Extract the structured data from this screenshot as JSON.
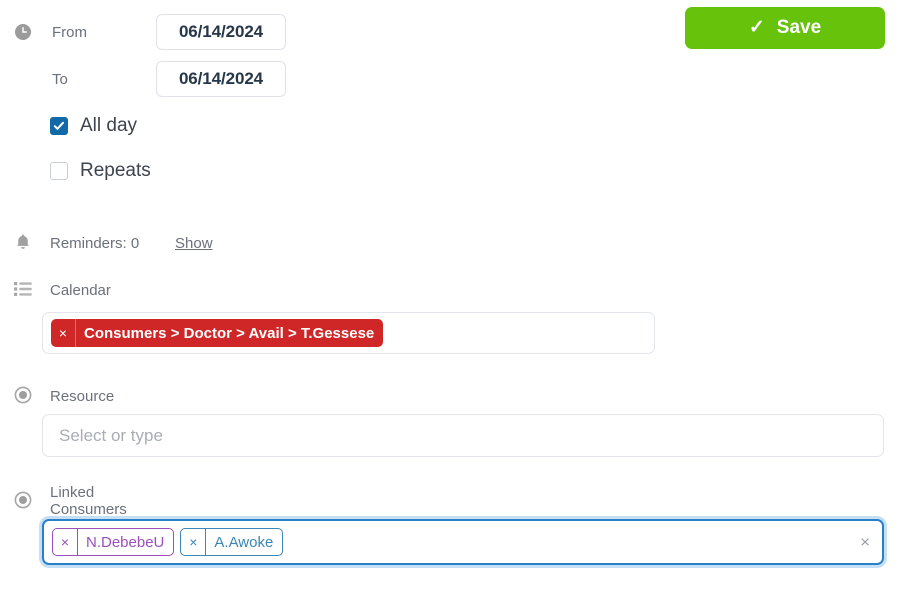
{
  "form": {
    "from": {
      "label": "From",
      "value": "06/14/2024",
      "icon": "clock-icon"
    },
    "to": {
      "label": "To",
      "value": "06/14/2024"
    },
    "all_day": {
      "label": "All day",
      "checked": true
    },
    "repeats": {
      "label": "Repeats",
      "checked": false
    },
    "reminders": {
      "icon": "bell-icon",
      "text": "Reminders: 0",
      "show_link": "Show"
    },
    "calendar": {
      "icon": "list-icon",
      "label": "Calendar",
      "tags": [
        {
          "label": "Consumers > Doctor > Avail > T.Gessese",
          "remove": "×",
          "color": "#cf2727",
          "style": "solid"
        }
      ]
    },
    "resource": {
      "icon": "radio-icon",
      "label": "Resource",
      "placeholder": "Select or type",
      "value": ""
    },
    "linked_consumers": {
      "icon": "radio-icon",
      "label": "Linked Consumers",
      "focused": true,
      "clear_all": "×",
      "tags": [
        {
          "label": "N.DebebeU",
          "remove": "×",
          "color": "#9b4fbd",
          "style": "outline"
        },
        {
          "label": "A.Awoke",
          "remove": "×",
          "color": "#3b87b5",
          "style": "outline"
        }
      ]
    }
  },
  "toolbar": {
    "save_label": "Save",
    "save_check": "✓",
    "save_color": "#66c20b"
  },
  "theme": {
    "accent_blue": "#1269a8",
    "focus_blue": "#2a7fc9",
    "label_gray": "#6b717b",
    "text_dark": "#27374a"
  }
}
